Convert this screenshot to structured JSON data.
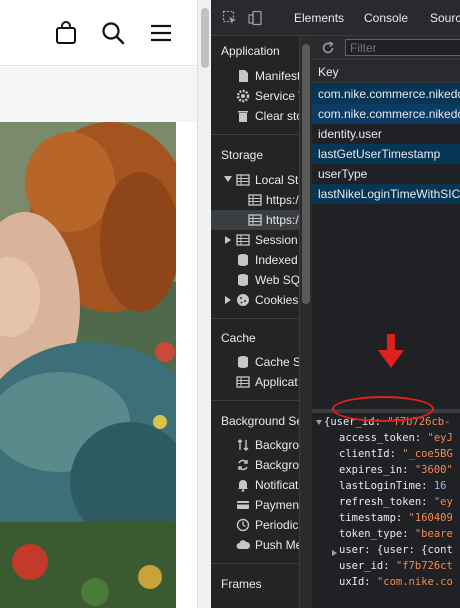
{
  "devtools": {
    "tabs": [
      "Elements",
      "Console",
      "Sourc"
    ],
    "sidebar": {
      "application_title": "Application",
      "application_items": [
        "Manifest",
        "Service W",
        "Clear sto"
      ],
      "storage_title": "Storage",
      "storage_items": [
        "Local Sto",
        "https:/",
        "https:/",
        "Session",
        "Indexed",
        "Web SQ",
        "Cookies"
      ],
      "cache_title": "Cache",
      "cache_items": [
        "Cache St",
        "Applicat"
      ],
      "background_title": "Background Se",
      "background_items": [
        "Backgro",
        "Backgro",
        "Notificat",
        "Paymen",
        "Periodic",
        "Push Me"
      ],
      "frames_title": "Frames"
    },
    "filter_placeholder": "Filter",
    "table": {
      "key_header": "Key",
      "rows": [
        "com.nike.commerce.nikedo",
        "com.nike.commerce.nikedo",
        "identity.user",
        "lastGetUserTimestamp",
        "userType",
        "lastNikeLoginTimeWithSICl"
      ]
    },
    "json": [
      {
        "k": "{user_id: ",
        "v": "\"f7b726cb-"
      },
      {
        "k": "access_token: ",
        "v": "\"eyJ"
      },
      {
        "k": "clientId: ",
        "v": "\"_coe5BG"
      },
      {
        "k": "expires_in: ",
        "v": "\"3600\""
      },
      {
        "k": "lastLoginTime: ",
        "v": "16"
      },
      {
        "k": "refresh_token: ",
        "v": "\"ey"
      },
      {
        "k": "timestamp: ",
        "v": "\"160409"
      },
      {
        "k": "token_type: ",
        "v": "\"beare"
      },
      {
        "k": "user: {user: {cont",
        "v": ""
      },
      {
        "k": "user_id: ",
        "v": "\"f7b726ct"
      },
      {
        "k": "uxId: ",
        "v": "\"com.nike.co"
      }
    ]
  },
  "colors": {
    "annotation": "#e02020",
    "selection": "#073655",
    "json_value": "#f28b54"
  }
}
